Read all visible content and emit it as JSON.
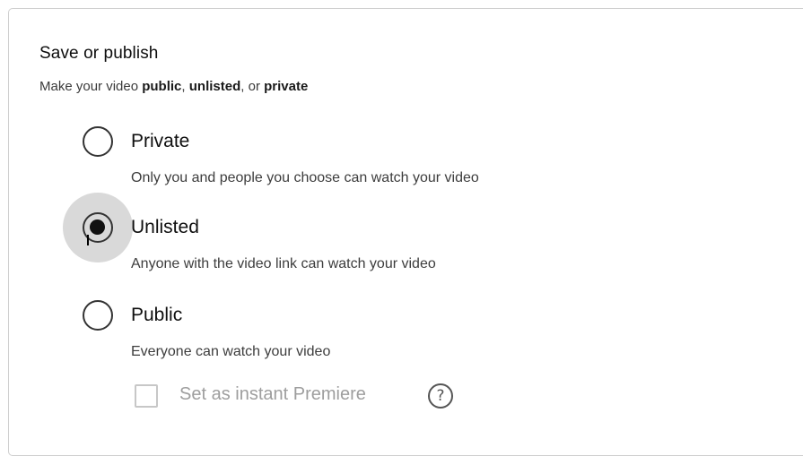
{
  "section": {
    "title": "Save or publish",
    "subtitle_prefix": "Make your video ",
    "subtitle_public": "public",
    "subtitle_sep1": ", ",
    "subtitle_unlisted": "unlisted",
    "subtitle_sep2": ", or ",
    "subtitle_private": "private"
  },
  "options": [
    {
      "label": "Private",
      "description": "Only you and people you choose can watch your video",
      "selected": false
    },
    {
      "label": "Unlisted",
      "description": "Anyone with the video link can watch your video",
      "selected": true
    },
    {
      "label": "Public",
      "description": "Everyone can watch your video",
      "selected": false
    }
  ],
  "premiere": {
    "label": "Set as instant Premiere",
    "checked": false,
    "help_icon": "?"
  }
}
